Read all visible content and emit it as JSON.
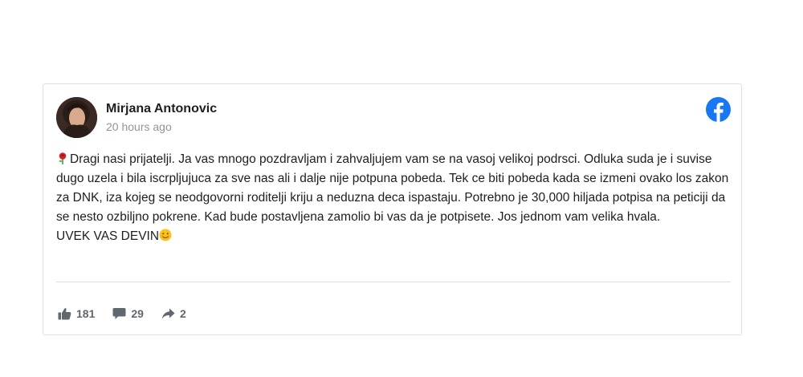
{
  "post": {
    "author": "Mirjana Antonovic",
    "time": "20 hours ago",
    "avatar_icon": "profile-photo",
    "platform_icon": "facebook-logo-icon",
    "brand_color": "#1877f2",
    "lead_emoji": "rose-emoji",
    "body_line_1": "Dragi nasi prijatelji. Ja vas mnogo pozdravljam i zahvaljujem vam se na vasoj velikoj podrsci. Odluka suda je i suvise dugo uzela i bila iscrpljujuca za sve nas ali i dalje nije potpuna pobeda. Tek ce biti pobeda kada se izmeni ovako los zakon za DNK, iza kojeg se neodgovorni roditelji kriju a neduzna deca ispastaju. Potrebno je 30,000 hiljada potpisa na peticiji da se nesto ozbiljno pokrene. Kad bude postavljena zamolio bi vas da je potpisete. Jos jednom vam velika hvala.",
    "body_line_2": "UVEK VAS DEVIN",
    "trail_emoji": "smiling-face-emoji"
  },
  "stats": {
    "likes": "181",
    "comments": "29",
    "shares": "2",
    "like_icon": "thumbs-up-icon",
    "comment_icon": "comment-icon",
    "share_icon": "share-arrow-icon"
  }
}
